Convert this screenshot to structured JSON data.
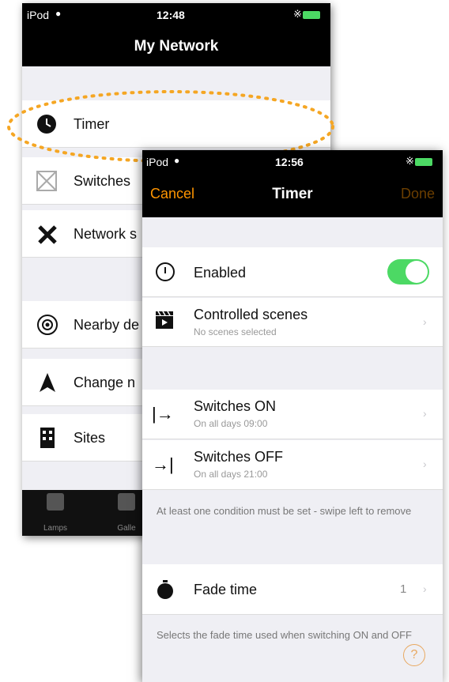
{
  "back": {
    "status": {
      "carrier": "iPod",
      "time": "12:48"
    },
    "title": "My Network",
    "items": [
      {
        "label": "Timer",
        "icon": "clock-icon"
      },
      {
        "label": "Switches",
        "icon": "switches-icon"
      },
      {
        "label": "Network s",
        "icon": "tools-icon"
      },
      {
        "label": "Nearby de",
        "icon": "nearby-devices-icon"
      },
      {
        "label": "Change n",
        "icon": "navigation-arrow-icon"
      },
      {
        "label": "Sites",
        "icon": "building-icon"
      }
    ],
    "tabs": [
      {
        "label": "Lamps"
      },
      {
        "label": "Galle"
      }
    ]
  },
  "front": {
    "status": {
      "carrier": "iPod",
      "time": "12:56"
    },
    "nav": {
      "cancel": "Cancel",
      "title": "Timer",
      "done": "Done"
    },
    "enabled": {
      "label": "Enabled",
      "on": true
    },
    "scenes": {
      "label": "Controlled scenes",
      "sub": "No scenes selected"
    },
    "switch_on": {
      "label": "Switches ON",
      "sub": "On all days 09:00"
    },
    "switch_off": {
      "label": "Switches OFF",
      "sub": "On all days 21:00"
    },
    "condition_note": "At least one condition must be set - swipe left to remove",
    "fade": {
      "label": "Fade time",
      "value": "1"
    },
    "fade_note": "Selects the fade time used when switching ON and OFF"
  },
  "colors": {
    "accent": "#ff9500",
    "toggle": "#4cd964",
    "highlight": "#f5a623"
  }
}
